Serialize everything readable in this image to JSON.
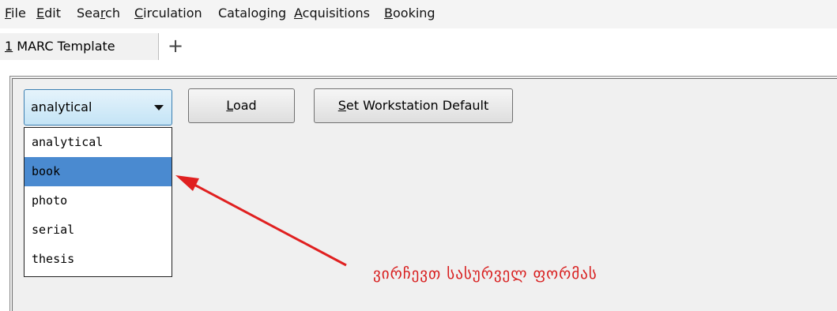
{
  "menu": {
    "items": [
      {
        "label": "File",
        "accel": "F",
        "rest": "ile"
      },
      {
        "label": "Edit",
        "accel": "E",
        "rest": "dit"
      },
      {
        "label": "Search",
        "pre": "Sea",
        "accel": "r",
        "rest": "ch"
      },
      {
        "label": "Circulation",
        "accel": "C",
        "rest": "irculation"
      },
      {
        "label": "Cataloging",
        "pre": "Catalo",
        "accel": "g",
        "rest": "ing"
      },
      {
        "label": "Acquisitions",
        "accel": "A",
        "rest": "cquisitions"
      },
      {
        "label": "Booking",
        "accel": "B",
        "rest": "ooking"
      }
    ]
  },
  "tabs": {
    "active": {
      "number": "1",
      "title": " MARC Template"
    },
    "add_symbol": "+"
  },
  "template_select": {
    "value": "analytical",
    "options": [
      "analytical",
      "book",
      "photo",
      "serial",
      "thesis"
    ],
    "highlighted": "book"
  },
  "buttons": {
    "load": {
      "accel": "L",
      "rest": "oad"
    },
    "set_default": {
      "accel": "S",
      "rest": "et Workstation Default"
    }
  },
  "annotation": {
    "text": "ვირჩევთ სასურველ ფორმას",
    "color": "#d81d1d"
  }
}
